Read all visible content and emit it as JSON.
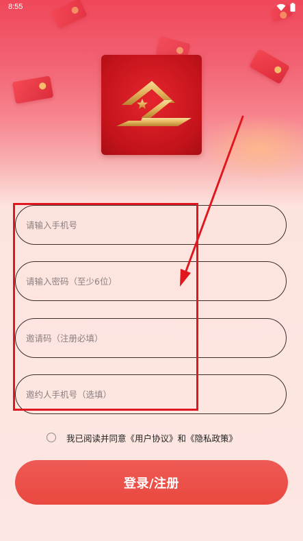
{
  "status_bar": {
    "time": "8:55",
    "icons": [
      "wifi-icon",
      "battery-icon"
    ]
  },
  "logo": {
    "icon": "app-logo-icon"
  },
  "form": {
    "phone_placeholder": "请输入手机号",
    "password_placeholder": "请输入密码（至少6位）",
    "invite_code_placeholder": "邀请码（注册必填）",
    "inviter_phone_placeholder": "邀约人手机号（选填）"
  },
  "agreement": {
    "text": "我已阅读并同意《用户协议》和《隐私政策》"
  },
  "login_button": {
    "label": "登录/注册"
  },
  "colors": {
    "brand_red": "#e9483f",
    "highlight_red": "#e0171f",
    "logo_gold": "#e8b864"
  }
}
